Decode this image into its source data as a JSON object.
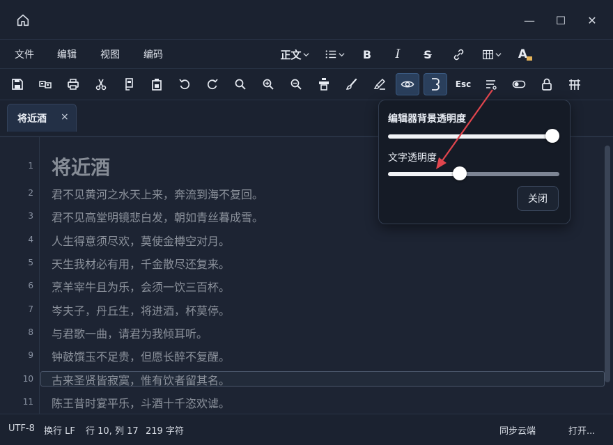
{
  "window": {
    "minimize_glyph": "—",
    "maximize_glyph": "☐",
    "close_glyph": "✕"
  },
  "menu": [
    "文件",
    "编辑",
    "视图",
    "编码"
  ],
  "format": {
    "style_label": "正文",
    "bold": "B",
    "italic": "I",
    "strike": "S",
    "text_color": "A"
  },
  "toolbar": {
    "esc_label": "Esc"
  },
  "tab": {
    "label": "将近酒",
    "close": "×"
  },
  "editor": {
    "lines": [
      "将近酒",
      "君不见黄河之水天上来，奔流到海不复回。",
      "君不见高堂明镜悲白发，朝如青丝暮成雪。",
      "人生得意须尽欢，莫使金樽空对月。",
      "天生我材必有用，千金散尽还复来。",
      "烹羊宰牛且为乐，会须一饮三百杯。",
      "岑夫子，丹丘生，将进酒，杯莫停。",
      "与君歌一曲，请君为我倾耳听。",
      "钟鼓馔玉不足贵，但愿长醉不复醒。",
      "古来圣贤皆寂寞，惟有饮者留其名。",
      "陈王昔时宴平乐，斗酒十千恣欢谑。"
    ],
    "line_numbers": [
      "1",
      "2",
      "3",
      "4",
      "5",
      "6",
      "7",
      "8",
      "9",
      "10",
      "11"
    ]
  },
  "popover": {
    "bg_label": "编辑器背景透明度",
    "bg_value": 1.0,
    "text_label": "文字透明度",
    "text_value": 0.42,
    "close_label": "关闭"
  },
  "status": {
    "encoding": "UTF-8",
    "eol": "换行 LF",
    "position": "行 10, 列 17",
    "chars": "219 字符",
    "sync": "同步云端",
    "open": "打开..."
  },
  "colors": {
    "accent": "#3b5a82",
    "arrow": "#e0454d"
  }
}
